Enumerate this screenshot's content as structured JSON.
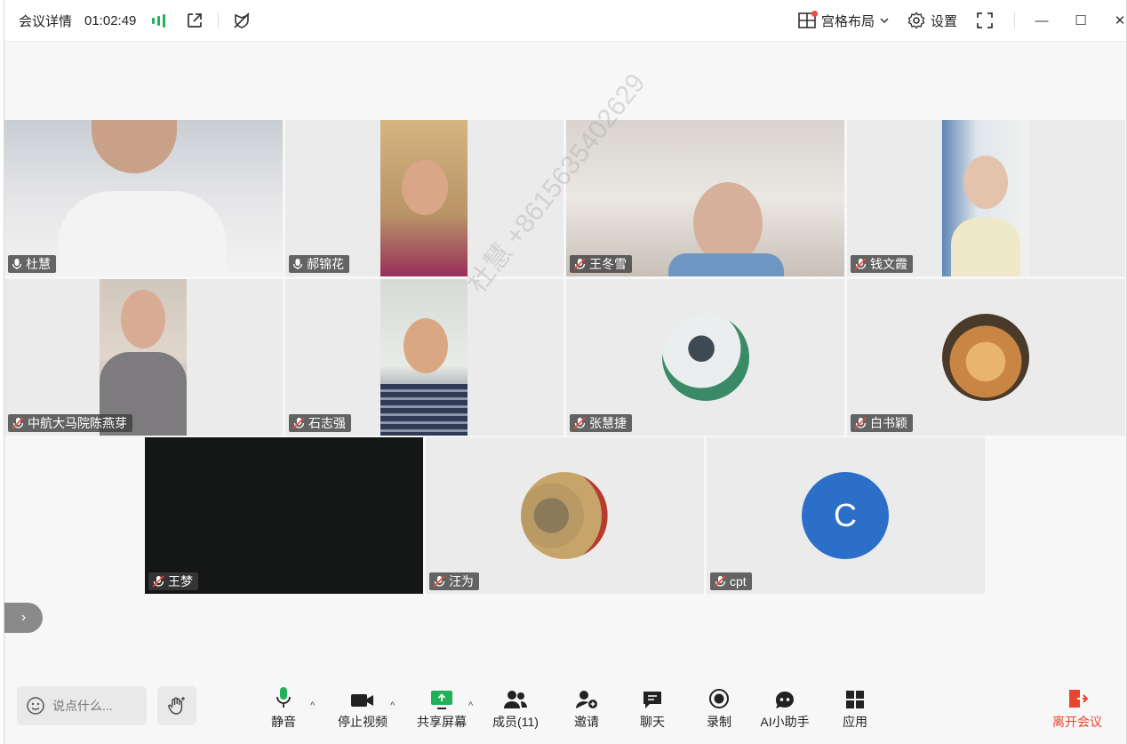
{
  "topbar": {
    "meeting_details": "会议详情",
    "timer": "01:02:49",
    "layout_label": "宫格布局",
    "settings_label": "设置"
  },
  "participants": [
    {
      "name": "杜慧",
      "mic": "on"
    },
    {
      "name": "郝锦花",
      "mic": "on"
    },
    {
      "name": "王冬雪",
      "mic": "muted"
    },
    {
      "name": "钱文霞",
      "mic": "muted"
    },
    {
      "name": "中航大马院陈燕芽",
      "mic": "muted"
    },
    {
      "name": "石志强",
      "mic": "muted"
    },
    {
      "name": "张慧捷",
      "mic": "muted"
    },
    {
      "name": "白书颖",
      "mic": "muted"
    },
    {
      "name": "王梦",
      "mic": "muted"
    },
    {
      "name": "汪为",
      "mic": "muted"
    },
    {
      "name": "cpt",
      "mic": "muted",
      "avatar_letter": "C",
      "avatar_color": "#2b6fc9"
    }
  ],
  "watermark": "杜慧 +8615635402629",
  "toolbar": {
    "chat_placeholder": "说点什么...",
    "mute": "静音",
    "stop_video": "停止视频",
    "share_screen": "共享屏幕",
    "members": "成员(11)",
    "invite": "邀请",
    "chat": "聊天",
    "record": "录制",
    "ai_assistant": "AI小助手",
    "apps": "应用",
    "leave": "离开会议"
  },
  "colors": {
    "active_border": "#3fbf7f",
    "leave_red": "#e8442e",
    "share_green": "#20b15a",
    "signal_green": "#20b15a"
  },
  "icons": [
    "meeting-signal-icon",
    "share-out-icon",
    "layout-grid-icon",
    "gear-icon",
    "fullscreen-icon",
    "minimize-icon",
    "maximize-icon",
    "close-icon",
    "mic-icon",
    "mic-muted-icon",
    "camera-icon",
    "share-screen-icon",
    "members-icon",
    "invite-icon",
    "chat-icon",
    "record-icon",
    "ai-icon",
    "apps-icon",
    "leave-icon",
    "raise-hand-icon",
    "emoji-icon",
    "chevron-right-icon"
  ]
}
